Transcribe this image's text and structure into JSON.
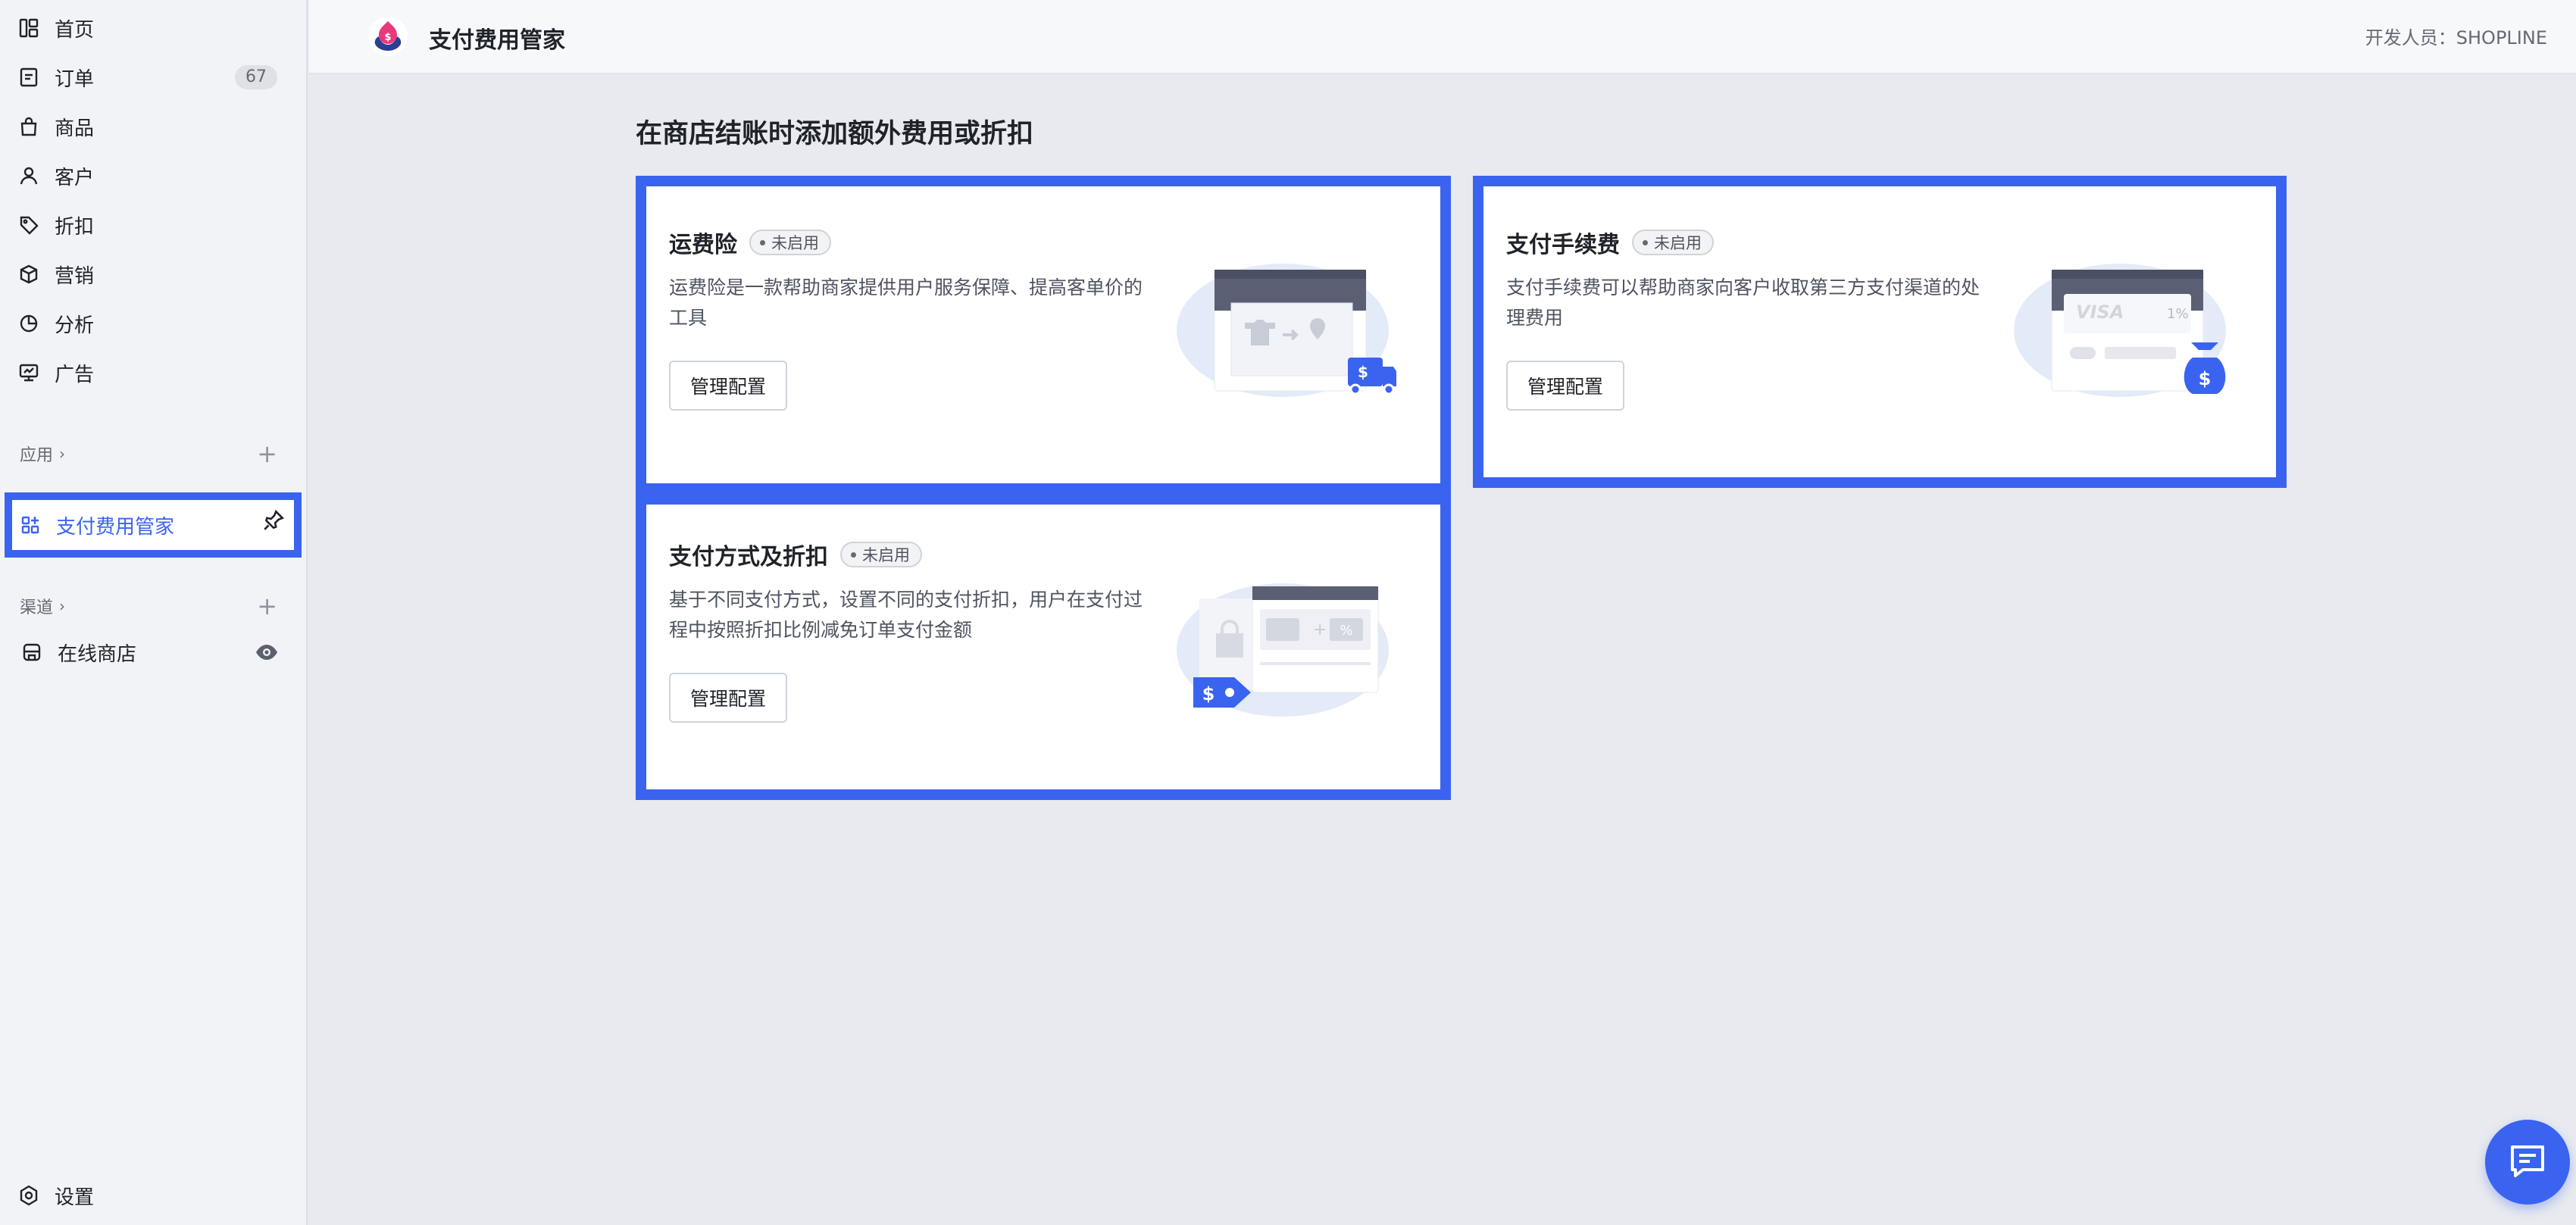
{
  "sidebar": {
    "items": [
      {
        "label": "首页",
        "icon": "dashboard-icon"
      },
      {
        "label": "订单",
        "icon": "order-icon",
        "badge": "67"
      },
      {
        "label": "商品",
        "icon": "bag-icon"
      },
      {
        "label": "客户",
        "icon": "user-icon"
      },
      {
        "label": "折扣",
        "icon": "tag-icon"
      },
      {
        "label": "营销",
        "icon": "box-icon"
      },
      {
        "label": "分析",
        "icon": "pie-icon"
      },
      {
        "label": "广告",
        "icon": "ad-icon"
      }
    ],
    "apps_label": "应用",
    "active_app": {
      "label": "支付费用管家",
      "icon": "apps-icon"
    },
    "channels_label": "渠道",
    "online_store": {
      "label": "在线商店",
      "icon": "store-icon"
    },
    "settings": {
      "label": "设置",
      "icon": "settings-icon"
    }
  },
  "header": {
    "title": "支付费用管家",
    "developer": "开发人员：SHOPLINE"
  },
  "main": {
    "heading": "在商店结账时添加额外费用或折扣",
    "cards": [
      {
        "title": "运费险",
        "status": "未启用",
        "description": "运费险是一款帮助商家提供用户服务保障、提高客单价的工具",
        "button": "管理配置"
      },
      {
        "title": "支付手续费",
        "status": "未启用",
        "description": "支付手续费可以帮助商家向客户收取第三方支付渠道的处理费用",
        "button": "管理配置",
        "illustration_text": {
          "card_brand": "VISA",
          "rate": "1%"
        }
      },
      {
        "title": "支付方式及折扣",
        "status": "未启用",
        "description": "基于不同支付方式，设置不同的支付折扣，用户在支付过程中按照折扣比例减免订单支付金额",
        "button": "管理配置",
        "illustration_text": {
          "percent": "%"
        }
      }
    ]
  },
  "colors": {
    "accent": "#3a63f0",
    "background": "#e8eaef",
    "sidebar": "#f2f3f6"
  }
}
